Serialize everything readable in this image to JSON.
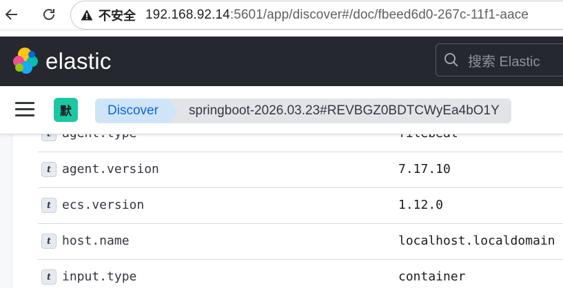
{
  "browser": {
    "security_label": "不安全",
    "url_host": "192.168.92.14",
    "url_rest": ":5601/app/discover#/doc/fbeed6d0-267c-11f1-aace"
  },
  "header": {
    "brand": "elastic",
    "search_placeholder": "搜索 Elastic"
  },
  "breadcrumbs": {
    "space_initial": "默",
    "items": [
      {
        "label": "Discover"
      },
      {
        "label": "springboot-2026.03.23#REVBGZ0BDTCWyEa4bO1Y"
      }
    ]
  },
  "doc_table": {
    "rows": [
      {
        "type": "t",
        "field": "agent.type",
        "value": "filebeat"
      },
      {
        "type": "t",
        "field": "agent.version",
        "value": "7.17.10"
      },
      {
        "type": "t",
        "field": "ecs.version",
        "value": "1.12.0"
      },
      {
        "type": "t",
        "field": "host.name",
        "value": "localhost.localdomain"
      },
      {
        "type": "t",
        "field": "input.type",
        "value": "container"
      }
    ]
  },
  "colors": {
    "header_bg": "#25282f",
    "crumb_active_bg": "#cfe5f7",
    "crumb_active_text": "#0b64dd",
    "space_avatar": "#1ec7a3"
  }
}
